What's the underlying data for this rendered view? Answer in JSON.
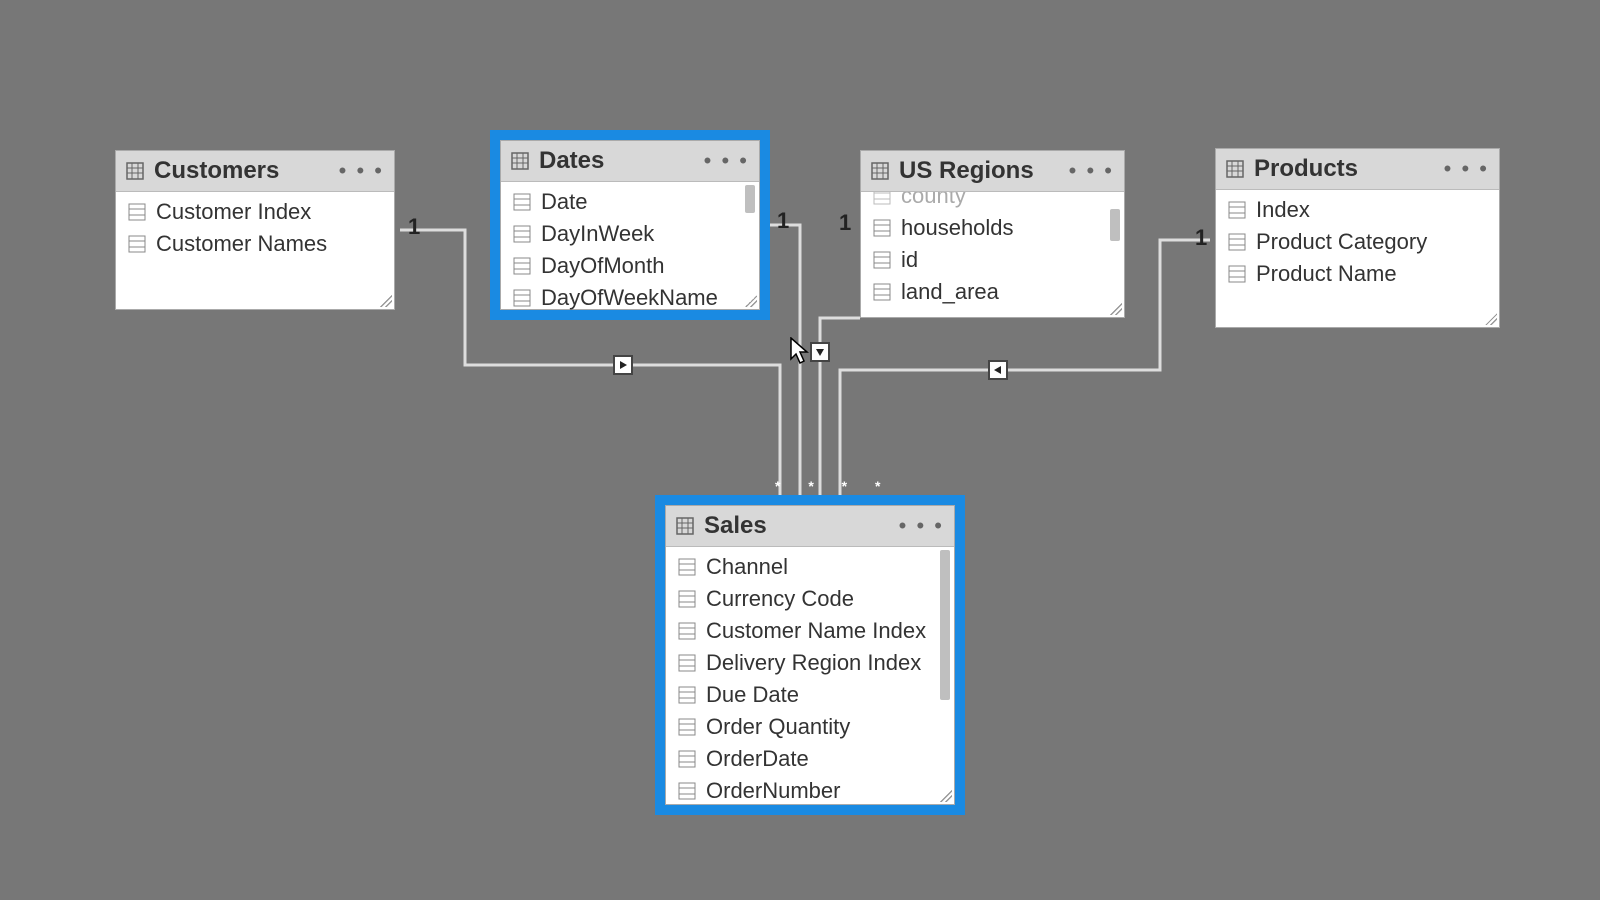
{
  "tables": {
    "customers": {
      "title": "Customers",
      "fields": [
        "Customer Index",
        "Customer Names"
      ]
    },
    "dates": {
      "title": "Dates",
      "fields": [
        "Date",
        "DayInWeek",
        "DayOfMonth",
        "DayOfWeekName"
      ]
    },
    "usregions": {
      "title": "US Regions",
      "scrolled_first": "county",
      "fields": [
        "households",
        "id",
        "land_area"
      ]
    },
    "products": {
      "title": "Products",
      "fields": [
        "Index",
        "Product Category",
        "Product Name"
      ]
    },
    "sales": {
      "title": "Sales",
      "fields": [
        "Channel",
        "Currency Code",
        "Customer Name Index",
        "Delivery Region Index",
        "Due Date",
        "Order Quantity",
        "OrderDate",
        "OrderNumber"
      ]
    }
  },
  "cardinality": {
    "customers_side": "1",
    "dates_side": "1",
    "usregions_side": "1",
    "products_side": "1"
  },
  "more_label": "• • •",
  "icons": {
    "table": "table-icon",
    "field": "field-icon",
    "more": "more-icon"
  }
}
